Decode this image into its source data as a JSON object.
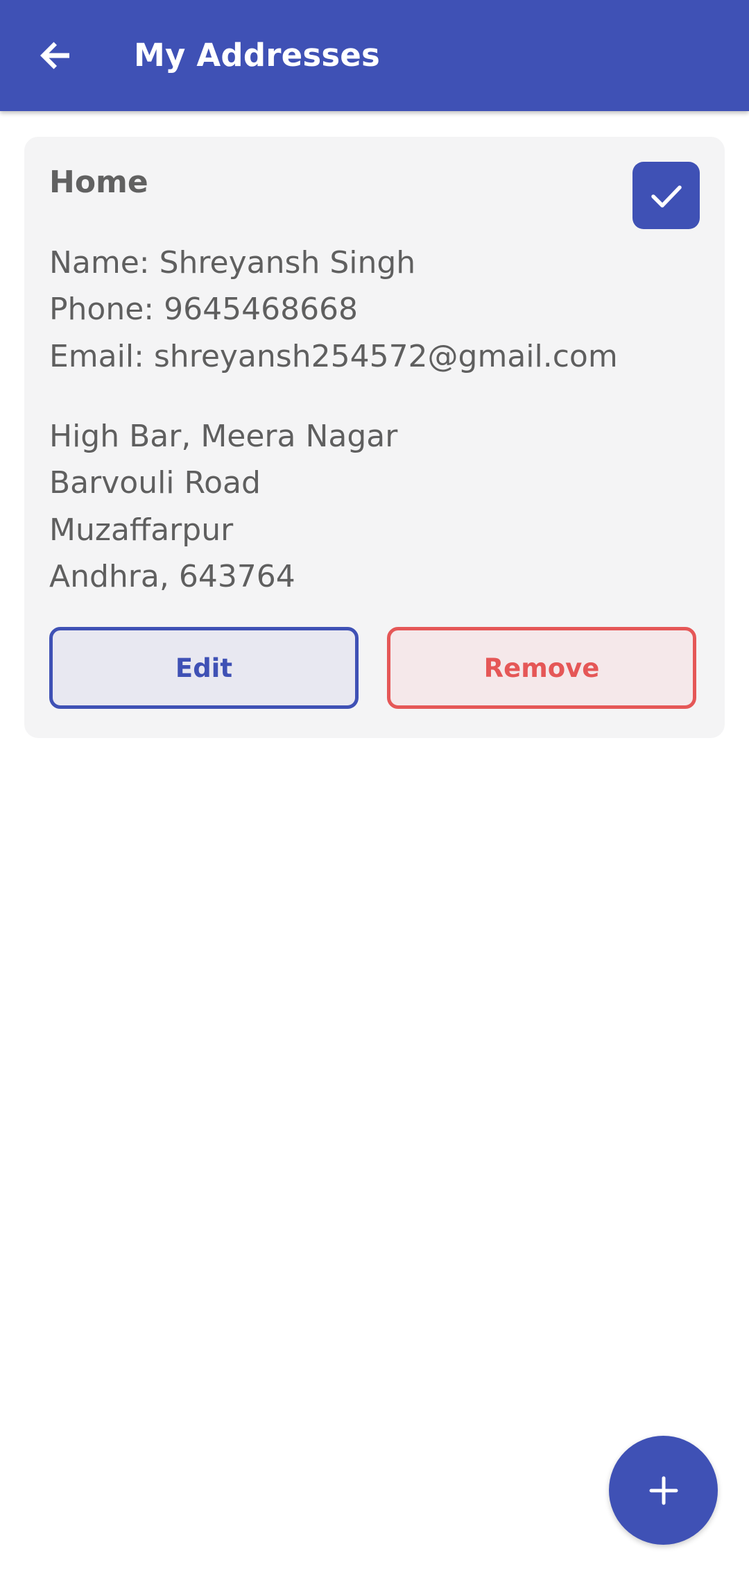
{
  "header": {
    "title": "My Addresses",
    "back_icon": "arrow-back-icon"
  },
  "address": {
    "label": "Home",
    "is_default": true,
    "default_icon": "check-icon",
    "name_line": "Name: Shreyansh Singh",
    "phone_line": "Phone: 9645468668",
    "email_line": "Email: shreyansh254572@gmail.com",
    "address_lines": [
      "High Bar, Meera Nagar",
      "Barvouli Road",
      "Muzaffarpur",
      "Andhra, 643764"
    ],
    "edit_label": "Edit",
    "remove_label": "Remove"
  },
  "fab": {
    "icon": "plus-icon"
  },
  "colors": {
    "primary": "#3f51b5",
    "danger": "#e55757",
    "card_bg": "#f4f4f5",
    "text": "#5f5f5f"
  }
}
